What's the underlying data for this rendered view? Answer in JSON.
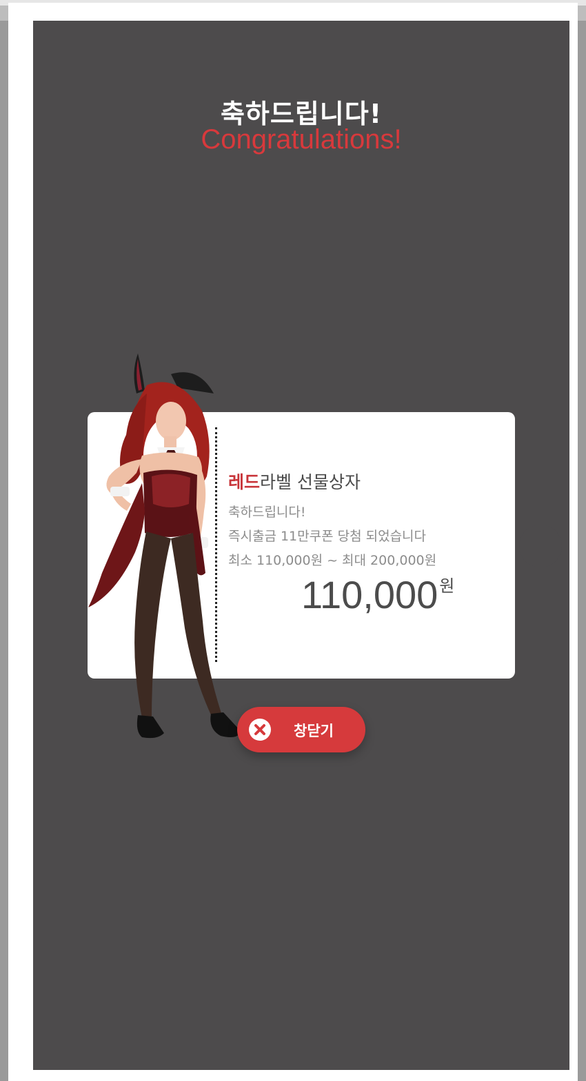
{
  "popup": {
    "title_ko": "축하드립니다!",
    "title_en": "Congratulations!"
  },
  "coupon": {
    "title_highlight": "레드",
    "title_rest": "라벨 선물상자",
    "line1": "축하드립니다!",
    "line2": "즉시출금 11만쿠폰 당첨 되었습니다",
    "line3": "최소 110,000원 ~ 최대 200,000원",
    "amount": "110,000",
    "amount_unit": "원"
  },
  "close_button": {
    "label": "창닫기",
    "icon": "close-icon"
  },
  "character": {
    "icon": "bunny-girl-illustration"
  },
  "colors": {
    "accent": "#d63a3c",
    "dark_bg": "#4d4b4c",
    "card_bg": "#ffffff"
  }
}
